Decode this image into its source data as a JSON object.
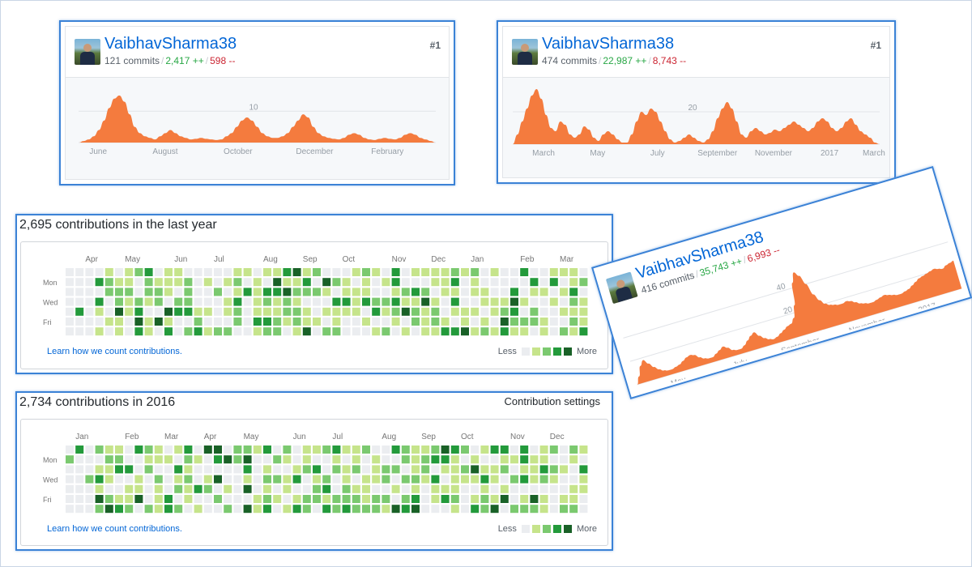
{
  "colors": {
    "area": "#f47b3e",
    "link": "#0366d6",
    "add": "#28a745",
    "del": "#cb2431",
    "levels": [
      "#ebedf0",
      "#c6e48b",
      "#7bc96f",
      "#239a3b",
      "#196127"
    ]
  },
  "cards": [
    {
      "username": "VaibhavSharma38",
      "commits": "121 commits",
      "additions": "2,417 ++",
      "deletions": "598 --",
      "rank": "#1",
      "chart_data": {
        "type": "area",
        "y_tick": "10",
        "x_labels": [
          "June",
          "August",
          "October",
          "December",
          "February"
        ],
        "x_pos": [
          0.085,
          0.26,
          0.45,
          0.65,
          0.84
        ],
        "values": [
          0,
          0.5,
          1,
          2,
          4,
          7,
          11,
          14,
          15,
          13,
          9,
          5,
          3,
          2,
          1.5,
          1,
          2,
          3,
          4,
          3,
          2,
          1.5,
          1,
          1.2,
          1.5,
          1.2,
          1,
          0.8,
          1,
          2,
          3,
          5,
          7,
          8,
          7,
          5,
          3,
          2,
          1.5,
          1.5,
          2,
          3,
          5,
          7,
          9,
          8,
          5,
          3,
          2,
          1.5,
          1.2,
          1,
          1.5,
          2.5,
          3,
          2.5,
          1.5,
          1,
          0.8,
          1.2,
          1.5,
          1.2,
          1,
          1.5,
          2.5,
          3,
          2.5,
          1.5,
          1,
          0.5,
          0
        ]
      }
    },
    {
      "username": "VaibhavSharma38",
      "commits": "474 commits",
      "additions": "22,987 ++",
      "deletions": "8,743 --",
      "rank": "#1",
      "chart_data": {
        "type": "area",
        "y_tick": "20",
        "x_labels": [
          "March",
          "May",
          "July",
          "September",
          "November",
          "2017",
          "March"
        ],
        "x_pos": [
          0.105,
          0.245,
          0.4,
          0.555,
          0.7,
          0.845,
          0.96
        ],
        "values": [
          0,
          6,
          14,
          22,
          30,
          34,
          28,
          18,
          10,
          8,
          14,
          12,
          6,
          4,
          6,
          11,
          9,
          4,
          2,
          6,
          8,
          6,
          3,
          1,
          1,
          6,
          14,
          20,
          18,
          22,
          20,
          14,
          8,
          3,
          1,
          2,
          4,
          6,
          4,
          2,
          1,
          3,
          8,
          16,
          22,
          26,
          22,
          14,
          6,
          4,
          8,
          10,
          8,
          6,
          7,
          9,
          8,
          10,
          12,
          14,
          12,
          10,
          8,
          10,
          14,
          16,
          14,
          10,
          8,
          10,
          14,
          16,
          12,
          8,
          6,
          4,
          1,
          0
        ]
      }
    },
    {
      "username": "VaibhavSharma38",
      "commits": "416 commits",
      "additions": "35,743 ++",
      "deletions": "6,993 --",
      "chart_data": {
        "type": "area",
        "y_ticks": [
          "40",
          "20"
        ],
        "x_labels": [
          "May",
          "July",
          "September",
          "November",
          "2017"
        ],
        "x_pos": [
          0.135,
          0.32,
          0.5,
          0.7,
          0.88
        ],
        "values": [
          0,
          6,
          14,
          18,
          14,
          10,
          7,
          5,
          4,
          4,
          5,
          6,
          8,
          10,
          11,
          10,
          7,
          5,
          4,
          4,
          6,
          8,
          10,
          8,
          5,
          4,
          4,
          6,
          9,
          12,
          14,
          10,
          7,
          5,
          4,
          5,
          7,
          9,
          11,
          12,
          16,
          26,
          44,
          52,
          48,
          40,
          30,
          24,
          20,
          18,
          17,
          16,
          16,
          17,
          16,
          14,
          12,
          11,
          10,
          10,
          11,
          12,
          13,
          12,
          11,
          10,
          10,
          11,
          12,
          14,
          16,
          18,
          19,
          20,
          21,
          22,
          21,
          20,
          22,
          23,
          24
        ]
      }
    }
  ],
  "contributions": [
    {
      "title": "2,695 contributions in the last year",
      "settings": "",
      "months": [
        "Apr",
        "May",
        "Jun",
        "Jul",
        "Aug",
        "Sep",
        "Oct",
        "Nov",
        "Dec",
        "Jan",
        "Feb",
        "Mar"
      ],
      "month_weeks": [
        2,
        6,
        11,
        15,
        20,
        24,
        28,
        33,
        37,
        41,
        46,
        50
      ],
      "days": [
        "Mon",
        "Wed",
        "Fri"
      ],
      "learn": "Learn how we count contributions.",
      "less": "Less",
      "more": "More",
      "seed": 7
    },
    {
      "title": "2,734 contributions in 2016",
      "settings": "Contribution settings",
      "months": [
        "Jan",
        "Feb",
        "Mar",
        "Apr",
        "May",
        "Jun",
        "Jul",
        "Aug",
        "Sep",
        "Oct",
        "Nov",
        "Dec"
      ],
      "month_weeks": [
        1,
        6,
        10,
        14,
        18,
        23,
        27,
        32,
        36,
        40,
        45,
        49
      ],
      "days": [
        "Mon",
        "Wed",
        "Fri"
      ],
      "learn": "Learn how we count contributions.",
      "less": "Less",
      "more": "More",
      "seed": 19
    }
  ]
}
